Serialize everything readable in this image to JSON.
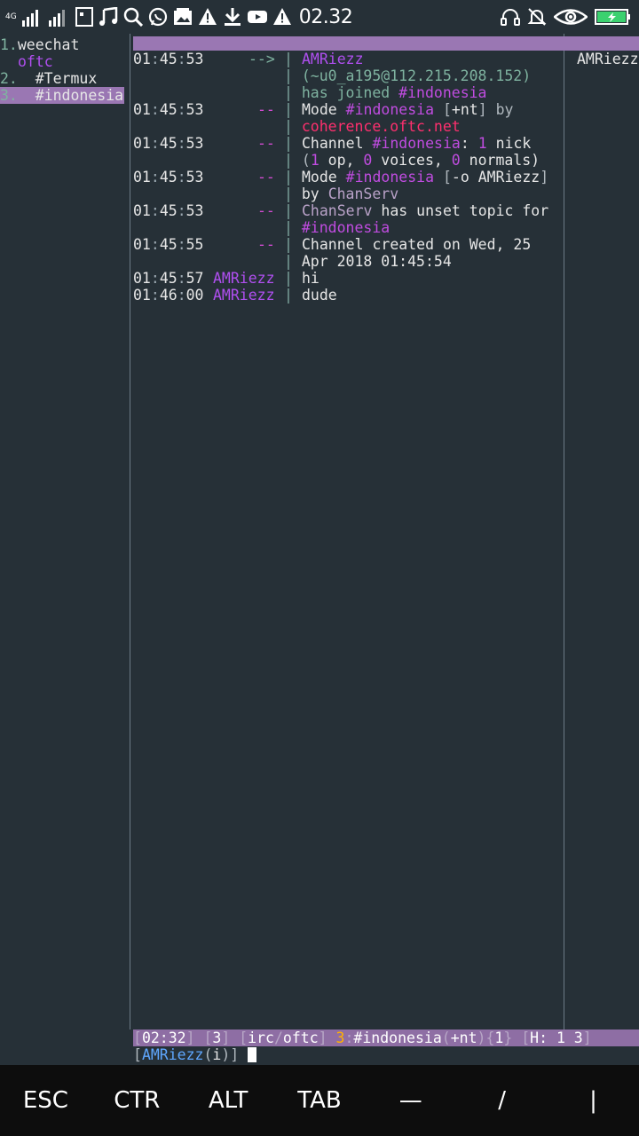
{
  "status_bar": {
    "network": "4G",
    "time": "02.32",
    "icons_left": [
      "signal-icon",
      "signal-icon",
      "screenshot-icon",
      "music-icon",
      "search-icon",
      "whatsapp-icon",
      "gallery-icon",
      "warning-icon",
      "download-icon",
      "youtube-icon",
      "warning-icon"
    ],
    "icons_right": [
      "headset-icon",
      "mute-icon",
      "eye-icon",
      "battery-icon"
    ],
    "battery_color": "#3bd16f"
  },
  "buflist": [
    {
      "num": "1.",
      "name": "weechat"
    },
    {
      "num": "",
      "name": "oftc"
    },
    {
      "num": "2.",
      "name": "  #Termux"
    },
    {
      "num": "3.",
      "name": "  #indonesia"
    }
  ],
  "nicklist": [
    "AMRiezz"
  ],
  "chat": {
    "l1": {
      "time_h": "01",
      "time_m": "45",
      "time_s": "53",
      "prefix": "-->",
      "nick": "AMRiezz"
    },
    "l2": {
      "host": "(~u0_a195@112.215.208.152)"
    },
    "l3": {
      "text": "has joined ",
      "chan": "#indonesia"
    },
    "l4": {
      "time_h": "01",
      "time_m": "45",
      "time_s": "53",
      "prefix": "--",
      "a": "Mode ",
      "chan": "#indonesia",
      "b": " [",
      "mode": "+nt",
      "c": "] by"
    },
    "l5": {
      "server": "coherence.oftc.net"
    },
    "l6": {
      "time_h": "01",
      "time_m": "45",
      "time_s": "53",
      "prefix": "--",
      "a": "Channel ",
      "chan": "#indonesia",
      "b": ": ",
      "n1": "1",
      "c": " nick"
    },
    "l7": {
      "a": "(",
      "n1": "1",
      "b": " op, ",
      "n2": "0",
      "c": " voices, ",
      "n3": "0",
      "d": " normals)"
    },
    "l8": {
      "time_h": "01",
      "time_m": "45",
      "time_s": "53",
      "prefix": "--",
      "a": "Mode ",
      "chan": "#indonesia",
      "b": " [",
      "mode": "-o AMRiezz",
      "c": "]"
    },
    "l9": {
      "a": "by ",
      "who": "ChanServ"
    },
    "l10": {
      "time_h": "01",
      "time_m": "45",
      "time_s": "53",
      "prefix": "--",
      "who": "ChanServ",
      "a": " has unset topic for"
    },
    "l11": {
      "chan": "#indonesia"
    },
    "l12": {
      "time_h": "01",
      "time_m": "45",
      "time_s": "55",
      "prefix": "--",
      "a": "Channel created on Wed, 25"
    },
    "l13": {
      "a": "Apr 2018 01:45:54"
    },
    "l14": {
      "time_h": "01",
      "time_m": "45",
      "time_s": "57",
      "nick": "AMRiezz",
      "msg": "hi"
    },
    "l15": {
      "time_h": "01",
      "time_m": "46",
      "time_s": "00",
      "nick": "AMRiezz",
      "msg": "dude"
    }
  },
  "statusline": {
    "clock": "02:32",
    "bufnum": "3",
    "plugin": "irc",
    "server": "oftc",
    "chnum": "3",
    "chan": "#indonesia",
    "modes": "+nt",
    "nicks": "1",
    "hot": "H: 1 3"
  },
  "input": {
    "nick": "AMRiezz",
    "mode": "i"
  },
  "extra_keys": [
    "ESC",
    "CTR",
    "ALT",
    "TAB",
    "—",
    "/",
    "|"
  ]
}
